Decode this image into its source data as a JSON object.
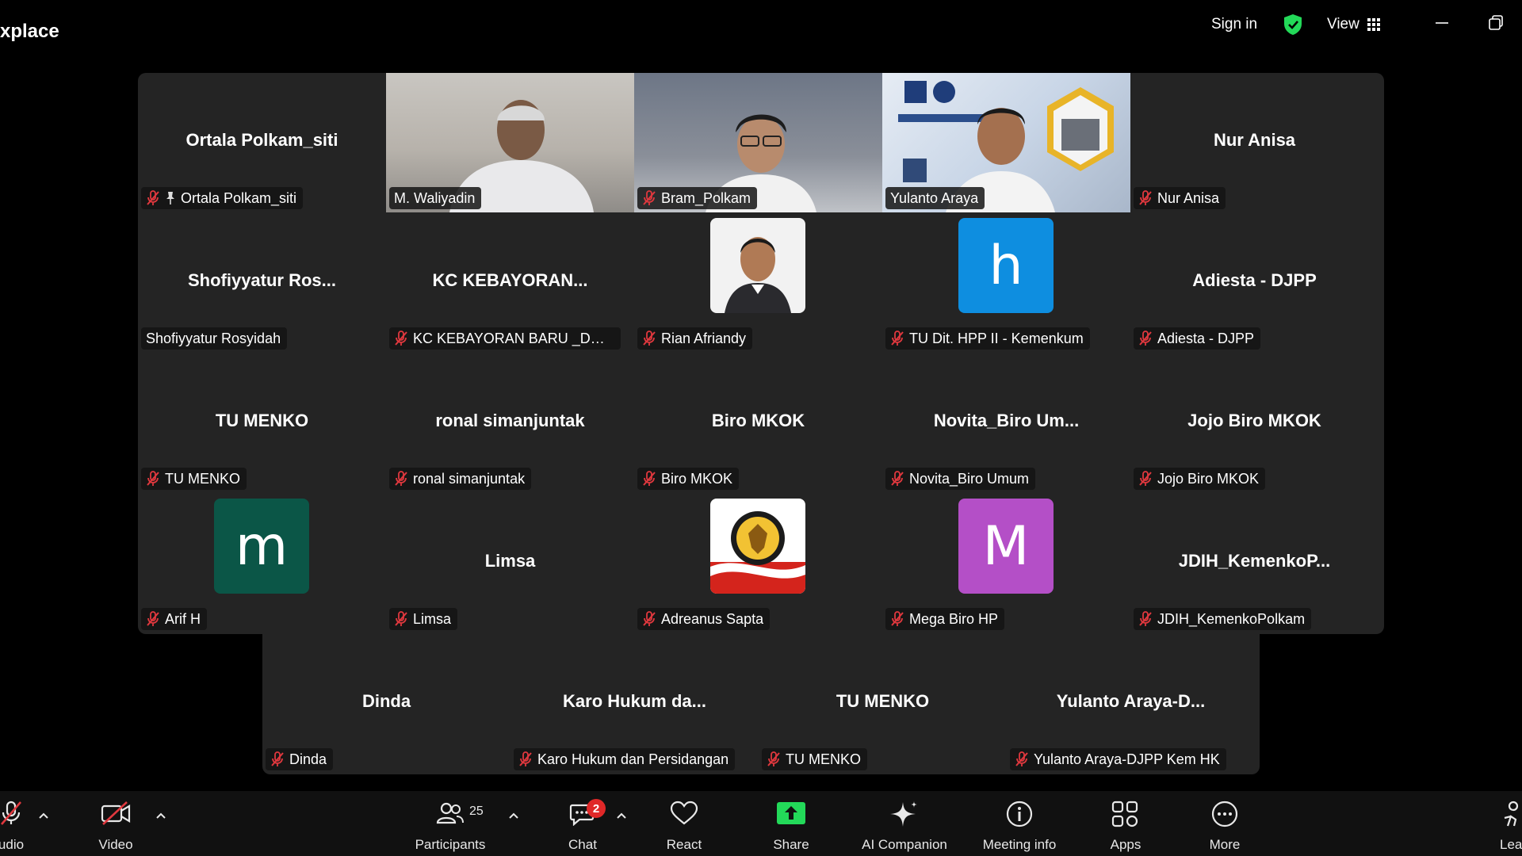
{
  "app": {
    "title": "xplace"
  },
  "topbar": {
    "sign_in": "Sign in",
    "view_label": "View"
  },
  "tiles": [
    {
      "display_name": "Ortala Polkam_siti",
      "label": "Ortala Polkam_siti"
    },
    {
      "display_name": "",
      "label": "M. Waliyadin"
    },
    {
      "display_name": "",
      "label": "Bram_Polkam"
    },
    {
      "display_name": "",
      "label": "Yulanto Araya"
    },
    {
      "display_name": "Nur Anisa",
      "label": "Nur Anisa"
    },
    {
      "display_name": "Shofiyyatur  Ros...",
      "label": "Shofiyyatur Rosyidah"
    },
    {
      "display_name": "KC KEBAYORAN...",
      "label": "KC KEBAYORAN BARU _Dwi R..."
    },
    {
      "display_name": "",
      "label": "Rian Afriandy"
    },
    {
      "display_name": "",
      "label": "TU Dit. HPP II - Kemenkum",
      "avatar_letter": "h",
      "avatar_color": "#0e8ee0"
    },
    {
      "display_name": "Adiesta - DJPP",
      "label": "Adiesta - DJPP"
    },
    {
      "display_name": "TU MENKO",
      "label": "TU MENKO"
    },
    {
      "display_name": "ronal simanjuntak",
      "label": "ronal simanjuntak"
    },
    {
      "display_name": "Biro MKOK",
      "label": "Biro MKOK"
    },
    {
      "display_name": "Novita_Biro  Um...",
      "label": "Novita_Biro Umum"
    },
    {
      "display_name": "Jojo Biro MKOK",
      "label": "Jojo Biro MKOK"
    },
    {
      "display_name": "",
      "label": "Arif H",
      "avatar_letter": "m",
      "avatar_color": "#0b5647"
    },
    {
      "display_name": "Limsa",
      "label": "Limsa"
    },
    {
      "display_name": "",
      "label": "Adreanus Sapta"
    },
    {
      "display_name": "",
      "label": "Mega Biro HP",
      "avatar_letter": "M",
      "avatar_color": "#b44fc7"
    },
    {
      "display_name": "JDIH_KemenkoP...",
      "label": "JDIH_KemenkoPolkam"
    },
    {
      "display_name": "Dinda",
      "label": "Dinda"
    },
    {
      "display_name": "Karo  Hukum  da...",
      "label": "Karo Hukum dan Persidangan"
    },
    {
      "display_name": "TU MENKO",
      "label": "TU MENKO"
    },
    {
      "display_name": "Yulanto  Araya-D...",
      "label": "Yulanto Araya-DJPP Kem HK"
    }
  ],
  "toolbar": {
    "audio": "udio",
    "video": "Video",
    "participants": "Participants",
    "participants_count": "25",
    "chat": "Chat",
    "chat_badge": "2",
    "react": "React",
    "share": "Share",
    "ai_companion": "AI Companion",
    "meeting_info": "Meeting info",
    "apps": "Apps",
    "more": "More",
    "leave": "Lea"
  },
  "colors": {
    "active_speaker": "#23d959",
    "muted_mic": "#e0383e",
    "share": "#23d959",
    "badge": "#e02828"
  }
}
